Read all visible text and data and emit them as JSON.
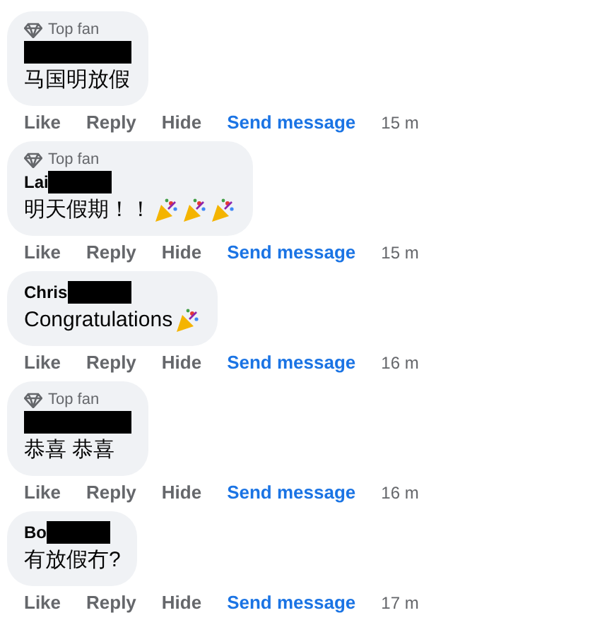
{
  "comments": [
    {
      "badge": "Top fan",
      "text": "马国明放假",
      "actions": [
        "Like",
        "Reply",
        "Hide"
      ],
      "message_link": "Send message",
      "time": "15 m"
    },
    {
      "badge": "Top fan",
      "name": "Lai",
      "text": "明天假期！！",
      "stickers": [
        {
          "kind": "party-popper"
        },
        {
          "kind": "party-popper"
        },
        {
          "kind": "party-popper"
        }
      ],
      "actions": [
        "Like",
        "Reply",
        "Hide"
      ],
      "message_link": "Send message",
      "time": "15 m"
    },
    {
      "name": "Chris",
      "text": "Congratulations",
      "stickers": [
        {
          "kind": "party-popper"
        }
      ],
      "actions": [
        "Like",
        "Reply",
        "Hide"
      ],
      "message_link": "Send message",
      "time": "16 m"
    },
    {
      "badge": "Top fan",
      "text": "恭喜 恭喜",
      "actions": [
        "Like",
        "Reply",
        "Hide"
      ],
      "message_link": "Send message",
      "time": "16 m"
    },
    {
      "name": "Bo",
      "text": "有放假冇?",
      "actions": [
        "Like",
        "Reply",
        "Hide"
      ],
      "message_link": "Send message",
      "time": "17 m"
    }
  ]
}
